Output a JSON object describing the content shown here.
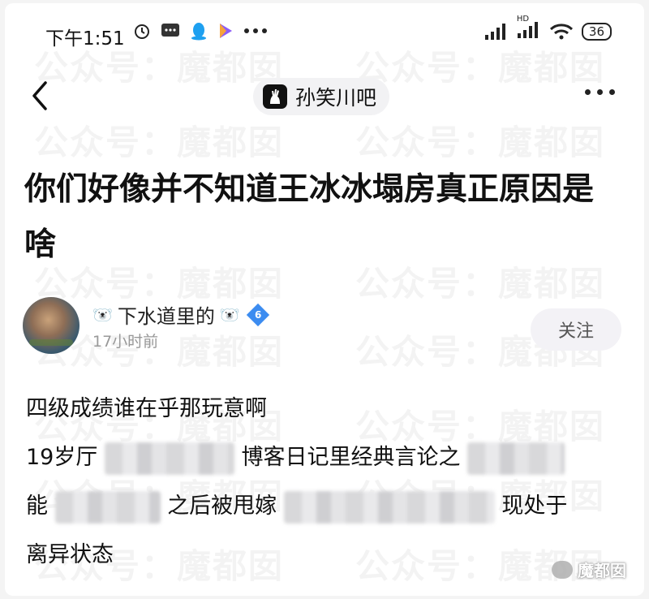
{
  "status_bar": {
    "time": "下午1:51",
    "network": "HD",
    "battery": "36"
  },
  "nav": {
    "forum_name": "孙笑川吧"
  },
  "post": {
    "title": "你们好像并不知道王冰冰塌房真正原因是啥",
    "author": {
      "name": "下水道里的",
      "level": "6",
      "time": "17小时前"
    },
    "follow_label": "关注",
    "lines": [
      {
        "before": "四级成绩谁在乎那玩意啊",
        "after": ""
      },
      {
        "before": "19岁厅",
        "after": "博客日记里经典言论之"
      },
      {
        "before": "能",
        "mid": "之后被甩嫁",
        "after": "现处于"
      },
      {
        "before": "离异状态",
        "after": ""
      }
    ]
  },
  "watermark": {
    "text": "公众号：魔都囡",
    "brand": "魔都囡"
  }
}
